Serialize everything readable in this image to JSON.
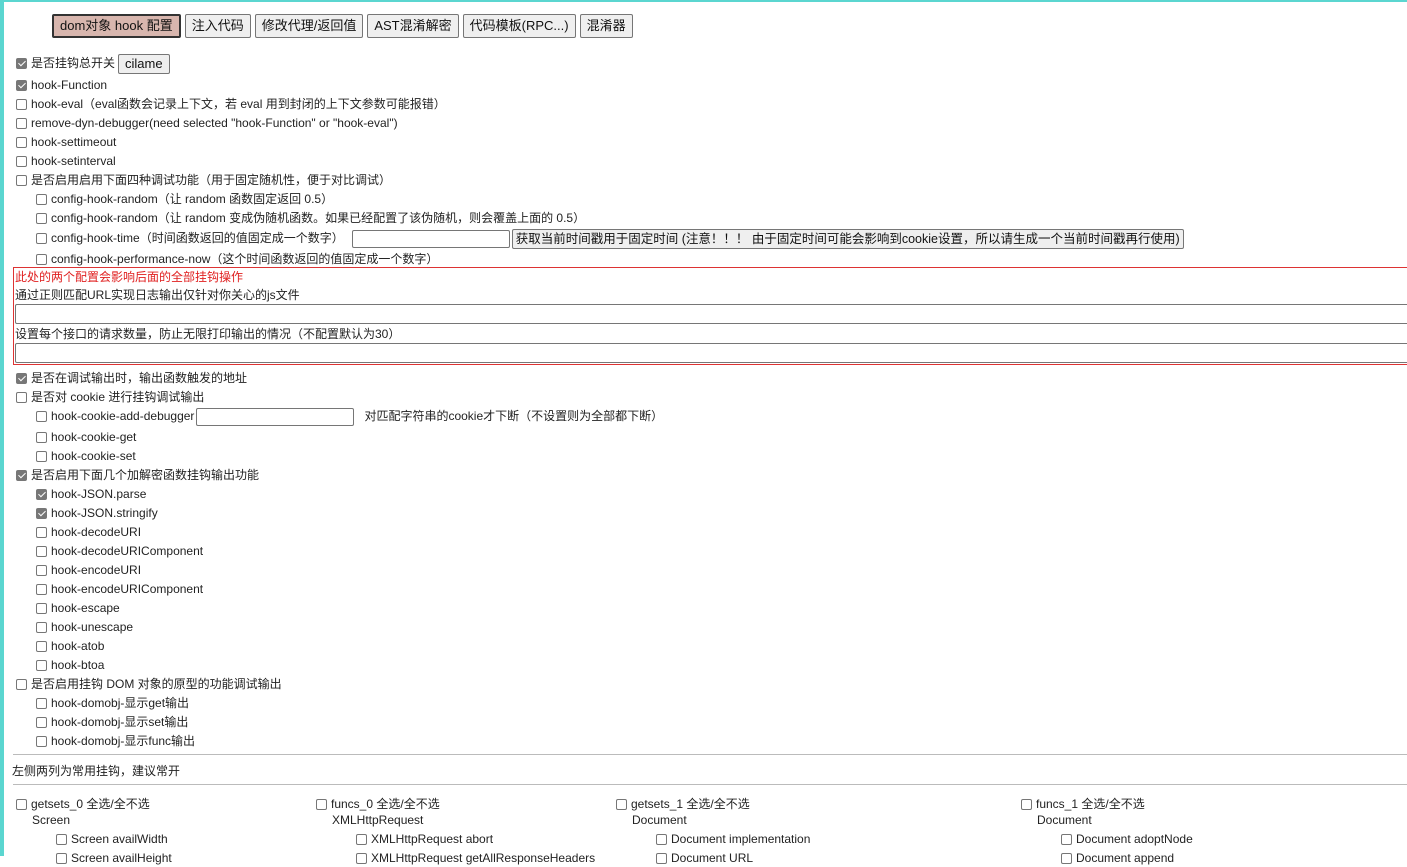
{
  "tabs": [
    "dom对象 hook 配置",
    "注入代码",
    "修改代理/返回值",
    "AST混淆解密",
    "代码模板(RPC...)",
    "混淆器"
  ],
  "master": {
    "label": "是否挂钩总开关",
    "checked": true,
    "button": "cilame"
  },
  "hook_function": {
    "label": "hook-Function",
    "checked": true
  },
  "hook_eval": {
    "label": "hook-eval（eval函数会记录上下文，若 eval 用到封闭的上下文参数可能报错）",
    "checked": false
  },
  "remove_dyn_debugger": {
    "label": "remove-dyn-debugger(need selected \"hook-Function\" or \"hook-eval\")",
    "checked": false
  },
  "hook_settimeout": {
    "label": "hook-settimeout",
    "checked": false
  },
  "hook_setinterval": {
    "label": "hook-setinterval",
    "checked": false
  },
  "debug_four": {
    "label": "是否启用启用下面四种调试功能（用于固定随机性，便于对比调试）",
    "checked": false
  },
  "config_random_1": {
    "label": "config-hook-random（让 random 函数固定返回 0.5）",
    "checked": false
  },
  "config_random_2": {
    "label": "config-hook-random（让 random 变成伪随机函数。如果已经配置了该伪随机，则会覆盖上面的 0.5）",
    "checked": false
  },
  "config_time": {
    "label": "config-hook-time（时间函数返回的值固定成一个数字）",
    "checked": false,
    "input_value": "",
    "button": "获取当前时间戳用于固定时间 (注意！！！ 由于固定时间可能会影响到cookie设置，所以请生成一个当前时间戳再行使用)"
  },
  "config_perf": {
    "label": "config-hook-performance-now（这个时间函数返回的值固定成一个数字）",
    "checked": false
  },
  "redbox": {
    "warning": "此处的两个配置会影响后面的全部挂钩操作",
    "url_label": "通过正则匹配URL实现日志输出仅针对你关心的js文件",
    "url_value": "",
    "limit_label": "设置每个接口的请求数量，防止无限打印输出的情况（不配置默认为30）",
    "limit_value": ""
  },
  "debug_addr": {
    "label": "是否在调试输出时，输出函数触发的地址",
    "checked": true
  },
  "cookie_hook": {
    "label": "是否对 cookie 进行挂钩调试输出",
    "checked": false
  },
  "cookie_add_debugger": {
    "label": "hook-cookie-add-debugger",
    "checked": false,
    "input_value": "",
    "note": "对匹配字符串的cookie才下断（不设置则为全部都下断）"
  },
  "cookie_get": {
    "label": "hook-cookie-get",
    "checked": false
  },
  "cookie_set": {
    "label": "hook-cookie-set",
    "checked": false
  },
  "crypto_hook": {
    "label": "是否启用下面几个加解密函数挂钩输出功能",
    "checked": true
  },
  "crypto_items": [
    {
      "label": "hook-JSON.parse",
      "checked": true
    },
    {
      "label": "hook-JSON.stringify",
      "checked": true
    },
    {
      "label": "hook-decodeURI",
      "checked": false
    },
    {
      "label": "hook-decodeURIComponent",
      "checked": false
    },
    {
      "label": "hook-encodeURI",
      "checked": false
    },
    {
      "label": "hook-encodeURIComponent",
      "checked": false
    },
    {
      "label": "hook-escape",
      "checked": false
    },
    {
      "label": "hook-unescape",
      "checked": false
    },
    {
      "label": "hook-atob",
      "checked": false
    },
    {
      "label": "hook-btoa",
      "checked": false
    }
  ],
  "domobj_hook": {
    "label": "是否启用挂钩 DOM 对象的原型的功能调试输出",
    "checked": false
  },
  "domobj_items": [
    {
      "label": "hook-domobj-显示get输出",
      "checked": false
    },
    {
      "label": "hook-domobj-显示set输出",
      "checked": false
    },
    {
      "label": "hook-domobj-显示func输出",
      "checked": false
    }
  ],
  "common_note": "左侧两列为常用挂钩，建议常开",
  "columns": [
    {
      "header": "getsets_0 全选/全不选",
      "group": "Screen",
      "item": "Screen availWidth",
      "item2": "Screen availHeight"
    },
    {
      "header": "funcs_0 全选/全不选",
      "group": "XMLHttpRequest",
      "item": "XMLHttpRequest abort",
      "item2": "XMLHttpRequest getAllResponseHeaders"
    },
    {
      "header": "getsets_1 全选/全不选",
      "group": "Document",
      "item": "Document implementation",
      "item2": "Document URL"
    },
    {
      "header": "funcs_1 全选/全不选",
      "group": "Document",
      "item": "Document adoptNode",
      "item2": "Document append"
    }
  ]
}
